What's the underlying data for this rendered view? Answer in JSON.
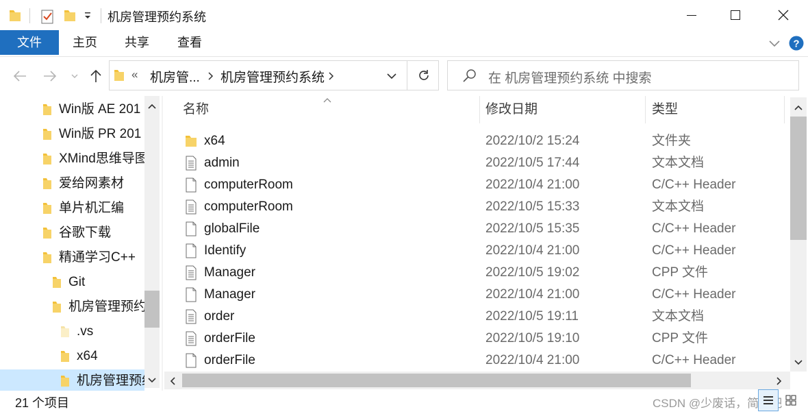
{
  "title": "机房管理预约系统",
  "ribbon_tabs": [
    "文件",
    "主页",
    "共享",
    "查看"
  ],
  "address": {
    "overflow": "«",
    "crumbs": [
      "机房管...",
      "机房管理预约系统"
    ]
  },
  "search": {
    "placeholder": "在 机房管理预约系统 中搜索"
  },
  "nav_items": [
    {
      "label": "Win版 AE 201"
    },
    {
      "label": "Win版 PR 201"
    },
    {
      "label": "XMind思维导图"
    },
    {
      "label": "爱给网素材"
    },
    {
      "label": "单片机汇编"
    },
    {
      "label": "谷歌下载"
    },
    {
      "label": "精通学习C++"
    },
    {
      "label": "Git"
    },
    {
      "label": "机房管理预约"
    },
    {
      "label": ".vs"
    },
    {
      "label": "x64"
    },
    {
      "label": "机房管理预约"
    }
  ],
  "columns": {
    "name": "名称",
    "date": "修改日期",
    "type": "类型"
  },
  "files": [
    {
      "name": "x64",
      "date": "2022/10/2 15:24",
      "type": "文件夹",
      "icon": "folder-icon"
    },
    {
      "name": "admin",
      "date": "2022/10/5 17:44",
      "type": "文本文档",
      "icon": "text-doc-icon"
    },
    {
      "name": "computerRoom",
      "date": "2022/10/4 21:00",
      "type": "C/C++ Header",
      "icon": "blank-doc-icon"
    },
    {
      "name": "computerRoom",
      "date": "2022/10/5 15:33",
      "type": "文本文档",
      "icon": "text-doc-icon"
    },
    {
      "name": "globalFile",
      "date": "2022/10/5 15:35",
      "type": "C/C++ Header",
      "icon": "blank-doc-icon"
    },
    {
      "name": "Identify",
      "date": "2022/10/4 21:00",
      "type": "C/C++ Header",
      "icon": "blank-doc-icon"
    },
    {
      "name": "Manager",
      "date": "2022/10/5 19:02",
      "type": "CPP 文件",
      "icon": "text-doc-icon"
    },
    {
      "name": "Manager",
      "date": "2022/10/4 21:00",
      "type": "C/C++ Header",
      "icon": "blank-doc-icon"
    },
    {
      "name": "order",
      "date": "2022/10/5 19:11",
      "type": "文本文档",
      "icon": "text-doc-icon"
    },
    {
      "name": "orderFile",
      "date": "2022/10/5 19:10",
      "type": "CPP 文件",
      "icon": "text-doc-icon"
    },
    {
      "name": "orderFile",
      "date": "2022/10/4 21:00",
      "type": "C/C++ Header",
      "icon": "blank-doc-icon"
    }
  ],
  "status": "21 个项目",
  "watermark": "CSDN @少废话，简明吧",
  "colors": {
    "accent": "#1f6fbf",
    "folder": "#f3c13a",
    "selection": "#cce8ff"
  }
}
